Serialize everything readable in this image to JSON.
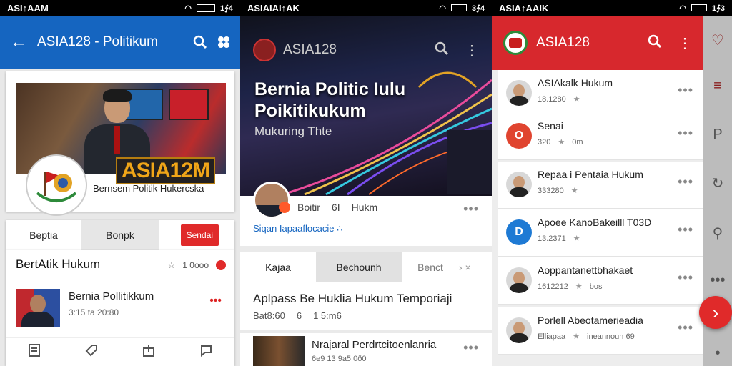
{
  "status": {
    "p1_left": "ASI↑AAM",
    "p1_right": "1∱4",
    "p2_left": "ASIAIAI↑AK",
    "p2_right": "3∱4",
    "p3_left": "ASIA↑AAIK",
    "p3_right": "1∱3"
  },
  "panel1": {
    "title": "ASIA128 - Politikum",
    "brand": "ASIA12M",
    "caption": "Bernsem Politik Hukercska",
    "tabs": [
      {
        "label": "Beptia"
      },
      {
        "label": "Bonpk"
      },
      {
        "label": "Sendai"
      }
    ],
    "feed_header": "BertAtik Hukum",
    "feed_header_meta": "1 0ooo",
    "item": {
      "title": "Bernia Pollitikkum",
      "meta": "3:15 ta 20:80"
    }
  },
  "panel2": {
    "brand": "ASIA128",
    "hero_title_1": "Bernia Politic Iulu",
    "hero_title_2": "Poikitikukum",
    "hero_sub": "Mukuring Thte",
    "meta_row": [
      "Boitir",
      "6I",
      "Hukm"
    ],
    "meta_sub": "Siqan Iapaaflocacie ∴",
    "tabs": [
      {
        "label": "Kajaa"
      },
      {
        "label": "Bechounh"
      },
      {
        "label": "Benct"
      }
    ],
    "article1": {
      "title": "Aplpass Be Huklia Hukum Temporiaji",
      "meta_a": "Bat8:60",
      "meta_b": "6",
      "meta_c": "1 5:m6"
    },
    "article2": {
      "title": "Nrajaral Perdrtcitoenlanria",
      "meta": "6e9 13 9a5 0ð0"
    }
  },
  "panel3": {
    "brand": "ASIA128",
    "rows": [
      {
        "name": "ASIAkalk Hukum",
        "meta": "18.1280",
        "avatar": "photo",
        "color": "#6a92c8"
      },
      {
        "name": "Senai",
        "meta": "320",
        "meta2": "0m",
        "avatar": "O",
        "color": "#e0442f"
      },
      {
        "name": "Repaa i Pentaia Hukum",
        "meta": "333280",
        "avatar": "photo",
        "color": "#a87755"
      },
      {
        "name": "Apoee KanoBakeilll T03D",
        "meta": "13.2371",
        "avatar": "D",
        "color": "#1e7ad4"
      },
      {
        "name": "Aoppantanettbhakaet",
        "meta": "1612212",
        "meta2": "bos",
        "avatar": "photo",
        "color": "#7b6a4a"
      },
      {
        "name": "Porlell Abeotamerieadia",
        "meta": "Elliapaa",
        "meta2": "ineannoun 69",
        "avatar": "photo",
        "color": "#5a3b30"
      }
    ]
  }
}
